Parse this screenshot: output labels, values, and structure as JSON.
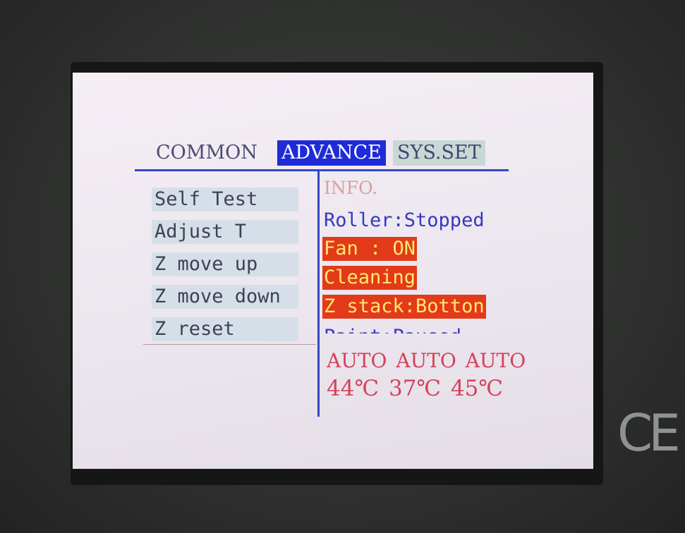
{
  "tabs": [
    {
      "label": "COMMON"
    },
    {
      "label": "ADVANCE"
    },
    {
      "label": "SYS.SET"
    }
  ],
  "menu": {
    "items": [
      {
        "label": "Self Test"
      },
      {
        "label": "Adjust T"
      },
      {
        "label": "Z move up"
      },
      {
        "label": "Z move down"
      },
      {
        "label": "Z reset"
      }
    ]
  },
  "info": {
    "title": "INFO.",
    "lines": [
      {
        "text": "Roller:Stopped"
      },
      {
        "text": "Fan : ON"
      },
      {
        "text": "Cleaning"
      },
      {
        "text": "Z stack:Botton"
      },
      {
        "text": "Paint:Paused"
      }
    ]
  },
  "temperatures": {
    "modes": "AUTO AUTO AUTO",
    "values": "44℃ 37℃ 45℃"
  },
  "device": {
    "mark": "CE"
  },
  "colors": {
    "active_tab": "#1e2bd6",
    "highlight": "#e33a1a",
    "highlight_text": "#ffe870",
    "temperature": "#d4425a"
  }
}
